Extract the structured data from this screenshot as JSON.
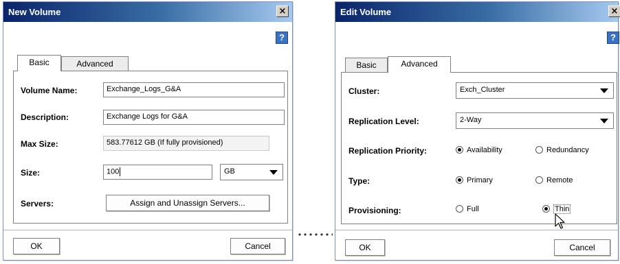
{
  "new_volume": {
    "title": "New Volume",
    "close_glyph": "×",
    "help_glyph": "?",
    "tabs": {
      "basic": "Basic",
      "advanced": "Advanced",
      "active": "Basic"
    },
    "fields": {
      "volume_name": {
        "label": "Volume Name:",
        "value": "Exchange_Logs_G&A"
      },
      "description": {
        "label": "Description:",
        "value": "Exchange Logs for G&A"
      },
      "max_size": {
        "label": "Max Size:",
        "value": "583.77612 GB (If fully provisioned)"
      },
      "size": {
        "label": "Size:",
        "value": "100",
        "unit": "GB"
      },
      "servers": {
        "label": "Servers:",
        "button": "Assign and Unassign Servers..."
      }
    },
    "ok_label": "OK",
    "cancel_label": "Cancel"
  },
  "edit_volume": {
    "title": "Edit Volume",
    "close_glyph": "×",
    "help_glyph": "?",
    "tabs": {
      "basic": "Basic",
      "advanced": "Advanced",
      "active": "Advanced"
    },
    "fields": {
      "cluster": {
        "label": "Cluster:",
        "value": "Exch_Cluster"
      },
      "replication_level": {
        "label": "Replication Level:",
        "value": "2-Way"
      },
      "replication_priority": {
        "label": "Replication Priority:",
        "options": [
          "Availability",
          "Redundancy"
        ],
        "selected": "Availability"
      },
      "type": {
        "label": "Type:",
        "options": [
          "Primary",
          "Remote"
        ],
        "selected": "Primary"
      },
      "provisioning": {
        "label": "Provisioning:",
        "options": [
          "Full",
          "Thin"
        ],
        "selected": "Thin"
      }
    },
    "ok_label": "OK",
    "cancel_label": "Cancel"
  },
  "icons": {
    "close": "close-icon",
    "help": "help-icon",
    "dropdown": "chevron-down-icon",
    "cursor": "mouse-pointer-icon"
  },
  "colors": {
    "title_start": "#0a246a",
    "title_end": "#a6caf0",
    "help_blue": "#3b73c4"
  }
}
